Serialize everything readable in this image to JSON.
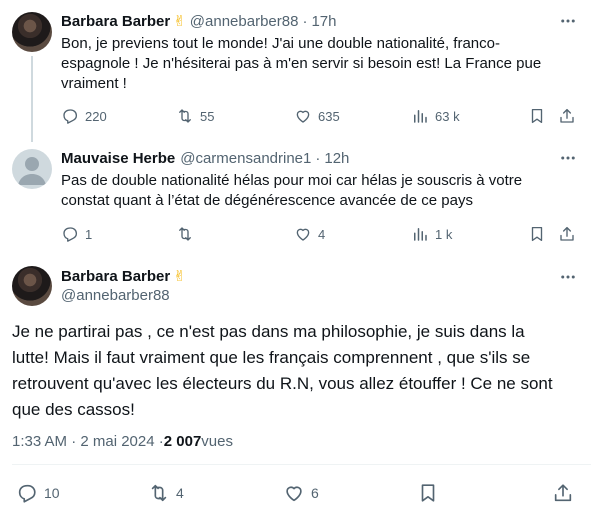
{
  "tweets": [
    {
      "name": "Barbara Barber",
      "emoji": "✌",
      "handle": "@annebarber88",
      "time": "17h",
      "text": "Bon, je previens tout le monde! J'ai une double nationalité, franco-\nespagnole ! Je n'hésiterai pas à m'en servir si besoin est! La France pue\nvraiment !",
      "replies": "220",
      "retweets": "55",
      "likes": "635",
      "views": "63 k"
    },
    {
      "name": "Mauvaise Herbe",
      "handle": "@carmensandrine1",
      "time": "12h",
      "text": "Pas de double nationalité hélas pour moi car hélas je souscris à votre\nconstat quant à l’état de dégénérescence avancée de ce pays",
      "replies": "1",
      "retweets": "",
      "likes": "4",
      "views": "1 k"
    }
  ],
  "main": {
    "name": "Barbara Barber",
    "emoji": "✌",
    "handle": "@annebarber88",
    "text": "Je ne partirai pas , ce n'est pas dans ma philosophie,  je suis dans la\nlutte!  Mais il faut vraiment que les français comprennent , que s'ils se\nretrouvent qu'avec les électeurs du R.N, vous allez étouffer ! Ce ne sont\nque des cassos!",
    "time_date": "1:33 AM · 2 mai 2024 · ",
    "views_count": "2 007",
    "views_label": " vues",
    "replies": "10",
    "retweets": "4",
    "likes": "6"
  },
  "icons": [
    "more-icon",
    "reply-icon",
    "retweet-icon",
    "like-icon",
    "views-icon",
    "bookmark-icon",
    "share-icon"
  ]
}
